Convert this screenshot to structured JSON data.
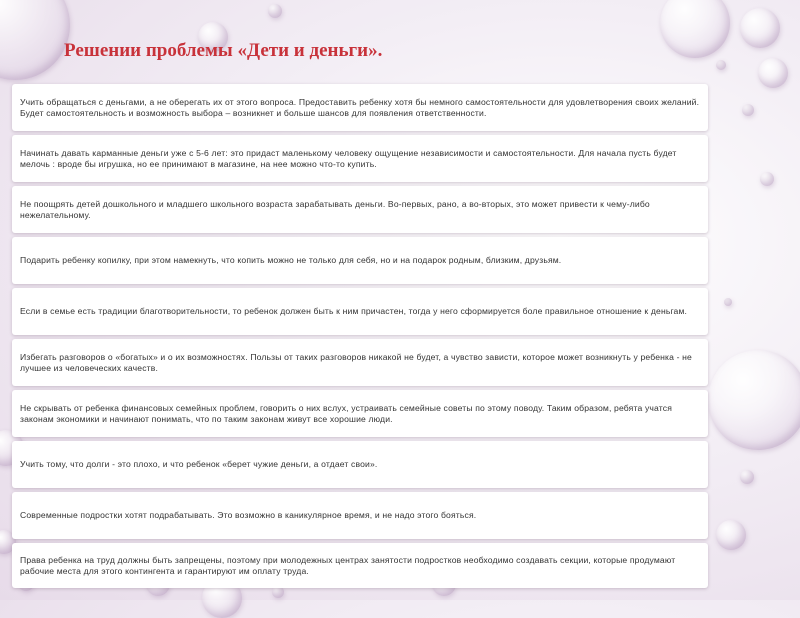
{
  "title": "Решении проблемы «Дети и деньги».",
  "items": [
    "Учить обращаться с деньгами, а не оберегать их от этого вопроса. Предоставить ребенку хотя бы немного самостоятельности для удовлетворения своих желаний. Будет самостоятельность и возможность выбора – возникнет и больше шансов для появления ответственности.",
    "Начинать давать карманные деньги уже с 5-6 лет: это придаст маленькому человеку ощущение независимости и самостоятельности. Для начала пусть будет мелочь : вроде бы игрушка, но ее принимают в магазине, на нее можно что-то купить.",
    "Не поощрять детей дошкольного и младшего школьного возраста зарабатывать деньги. Во-первых, рано, а во-вторых, это может привести к чему-либо нежелательному.",
    "Подарить ребенку копилку, при этом намекнуть, что копить можно не только для себя, но и на подарок родным, близким, друзьям.",
    "Если в семье есть традиции благотворительности, то ребенок должен быть к ним причастен, тогда у него сформируется боле правильное отношение к деньгам.",
    "Избегать разговоров о «богатых» и о их возможностях. Пользы от таких разговоров никакой не будет, а чувство зависти, которое может возникнуть у ребенка - не лучшее из человеческих качеств.",
    "Не скрывать от ребенка финансовых семейных проблем, говорить о них вслух, устраивать семейные советы по этому поводу. Таким образом, ребята учатся законам экономики и начинают понимать, что по таким законам живут все хорошие люди.",
    "Учить тому, что долги - это плохо, и что ребенок «берет чужие деньги, а отдает свои».",
    "Современные подростки хотят подрабатывать. Это возможно в каникулярное время, и не надо этого бояться.",
    "Права ребенка на труд должны быть запрещены, поэтому при молодежных центрах занятости подростков необходимо создавать секции, которые продумают рабочие места для этого контингента и гарантируют им оплату труда."
  ]
}
